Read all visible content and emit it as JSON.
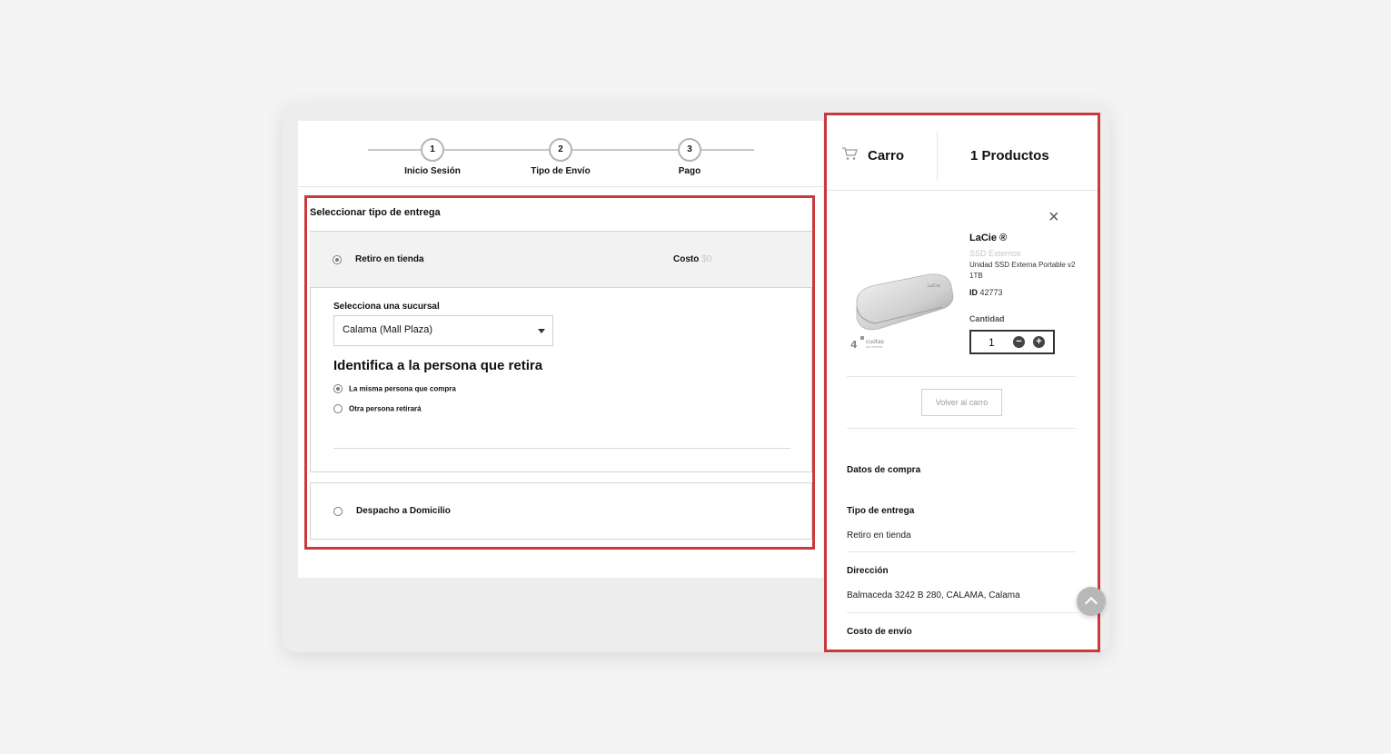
{
  "stepper": {
    "steps": [
      {
        "number": "1",
        "label": "Inicio Sesión"
      },
      {
        "number": "2",
        "label": "Tipo de Envío"
      },
      {
        "number": "3",
        "label": "Pago"
      }
    ]
  },
  "delivery": {
    "title": "Seleccionar tipo de entrega",
    "store_option": {
      "label": "Retiro en tienda",
      "cost_label": "Costo",
      "cost_value": "$0",
      "selected": true
    },
    "branch_label": "Selecciona una sucursal",
    "branch_selected": "Calama (Mall Plaza)",
    "person_heading": "Identifica a la persona que retira",
    "person_options": [
      {
        "label": "La misma persona que compra",
        "selected": true
      },
      {
        "label": "Otra persona retirará",
        "selected": false
      }
    ],
    "home_option": {
      "label": "Despacho a Domicilio",
      "selected": false
    }
  },
  "cart": {
    "title": "Carro",
    "count_label": "1 Productos",
    "item": {
      "brand": "LaCie ®",
      "category": "SSD Externos",
      "name": "Unidad SSD Externa Portable v2 1TB",
      "id_label": "ID",
      "id_value": "42773",
      "qty_label": "Cantidad",
      "qty": "1",
      "badge_number": "4",
      "badge_text": "cuotas",
      "badge_sub": "sin interés"
    },
    "back_button": "Volver al carro",
    "summary_title": "Datos de compra",
    "summary": [
      {
        "label": "Tipo de entrega",
        "value": "Retiro en tienda"
      },
      {
        "label": "Dirección",
        "value": "Balmaceda 3242 B 280, CALAMA, Calama"
      },
      {
        "label": "Costo de envío",
        "value": ""
      }
    ]
  },
  "colors": {
    "highlight": "#c9393e",
    "background": "#f4f4f5"
  }
}
